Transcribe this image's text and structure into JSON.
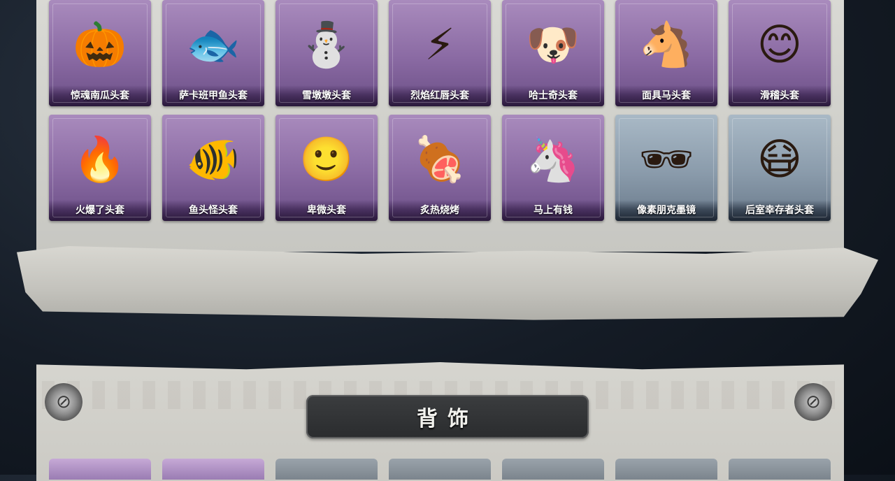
{
  "accent_purple": "#8a6aa3",
  "accent_blue": "#8a9bab",
  "headwear_row1": [
    {
      "label": "惊魂南瓜头套",
      "icon": "pumpkin-icon",
      "glyph": "🎃",
      "rarity": "purple"
    },
    {
      "label": "萨卡班甲鱼头套",
      "icon": "fish-icon",
      "glyph": "🐟",
      "rarity": "purple"
    },
    {
      "label": "雪墩墩头套",
      "icon": "snowman-icon",
      "glyph": "⛄",
      "rarity": "purple"
    },
    {
      "label": "烈焰红唇头套",
      "icon": "pikachu-mask-icon",
      "glyph": "⚡",
      "rarity": "purple"
    },
    {
      "label": "哈士奇头套",
      "icon": "dog-icon",
      "glyph": "🐶",
      "rarity": "purple"
    },
    {
      "label": "面具马头套",
      "icon": "horse-icon",
      "glyph": "🐴",
      "rarity": "purple"
    },
    {
      "label": "滑稽头套",
      "icon": "smiley-icon",
      "glyph": "😊",
      "rarity": "purple"
    }
  ],
  "headwear_row2": [
    {
      "label": "火爆了头套",
      "icon": "fire-icon",
      "glyph": "🔥",
      "rarity": "purple"
    },
    {
      "label": "鱼头怪头套",
      "icon": "fish-head-icon",
      "glyph": "🐠",
      "rarity": "purple"
    },
    {
      "label": "卑微头套",
      "icon": "humble-face-icon",
      "glyph": "🙂",
      "rarity": "purple"
    },
    {
      "label": "炙热烧烤",
      "icon": "bbq-meat-icon",
      "glyph": "🍖",
      "rarity": "purple"
    },
    {
      "label": "马上有钱",
      "icon": "pony-icon",
      "glyph": "🦄",
      "rarity": "purple"
    },
    {
      "label": "像素朋克墨镜",
      "icon": "pixel-sunglasses-icon",
      "glyph": "🕶",
      "rarity": "blue"
    },
    {
      "label": "后室幸存者头套",
      "icon": "gas-mask-icon",
      "glyph": "😷",
      "rarity": "blue"
    }
  ],
  "section_title": "背饰",
  "bottom_row_rarities": [
    "purple",
    "purple",
    "gray",
    "gray",
    "gray",
    "gray",
    "gray"
  ]
}
